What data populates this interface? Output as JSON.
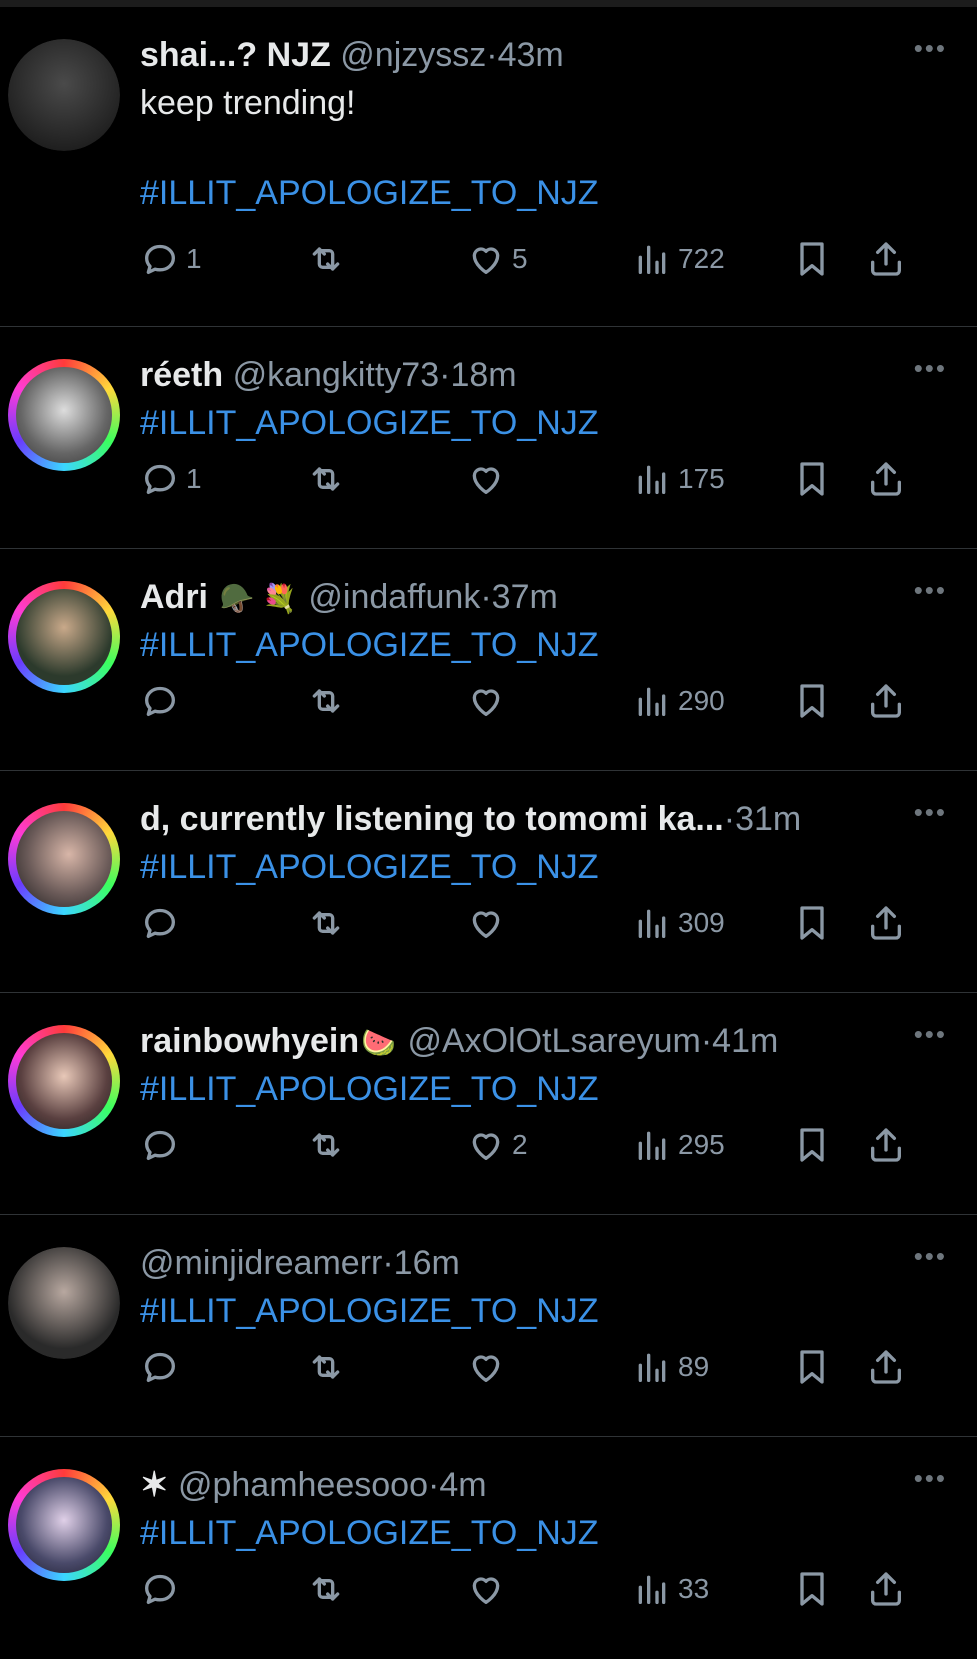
{
  "tweets": [
    {
      "name": "shai...? NJZ",
      "emoji": "",
      "handle": "@njzyssz",
      "time": "43m",
      "text": "keep trending!",
      "hashtag": "#ILLIT_APOLOGIZE_TO_NJZ",
      "replies": "1",
      "retweets": "",
      "likes": "5",
      "views": "722",
      "avatar": "#2a2a2a"
    },
    {
      "name": "réeth",
      "emoji": "",
      "handle": "@kangkitty73",
      "time": "18m",
      "text": "",
      "hashtag": "#ILLIT_APOLOGIZE_TO_NJZ",
      "replies": "1",
      "retweets": "",
      "likes": "",
      "views": "175",
      "avatar": "#6b6b6b"
    },
    {
      "name": "Adri",
      "emoji": "🪖 💐",
      "handle": "@indaffunk",
      "time": "37m",
      "text": "",
      "hashtag": "#ILLIT_APOLOGIZE_TO_NJZ",
      "replies": "",
      "retweets": "",
      "likes": "",
      "views": "290",
      "avatar": "#3a4a3a"
    },
    {
      "name": "d, currently listening to tomomi ka...",
      "emoji": "",
      "handle": "",
      "time": "31m",
      "text": "",
      "hashtag": "#ILLIT_APOLOGIZE_TO_NJZ",
      "replies": "",
      "retweets": "",
      "likes": "",
      "views": "309",
      "avatar": "#5a4a4a"
    },
    {
      "name": "rainbowhyein",
      "emoji": "🍉",
      "handle": "@AxOlOtLsareyum",
      "time": "41m",
      "text": "",
      "hashtag": "#ILLIT_APOLOGIZE_TO_NJZ",
      "replies": "",
      "retweets": "",
      "likes": "2",
      "views": "295",
      "avatar": "#8a6a6a"
    },
    {
      "name": "",
      "emoji": "",
      "handle": "@minjidreamerr",
      "time": "16m",
      "text": "",
      "hashtag": "#ILLIT_APOLOGIZE_TO_NJZ",
      "replies": "",
      "retweets": "",
      "likes": "",
      "views": "89",
      "avatar": "#3a3a3a"
    },
    {
      "name": "✶",
      "emoji": "",
      "handle": "@phamheesooo",
      "time": "4m",
      "text": "",
      "hashtag": "#ILLIT_APOLOGIZE_TO_NJZ",
      "replies": "",
      "retweets": "",
      "likes": "",
      "views": "33",
      "avatar": "#4a5a6a"
    }
  ],
  "ui": {
    "more": "•••",
    "dot": "·"
  },
  "colors": {
    "hashtag": "#3b91e6",
    "muted": "#8b98a5",
    "background": "#000000"
  }
}
